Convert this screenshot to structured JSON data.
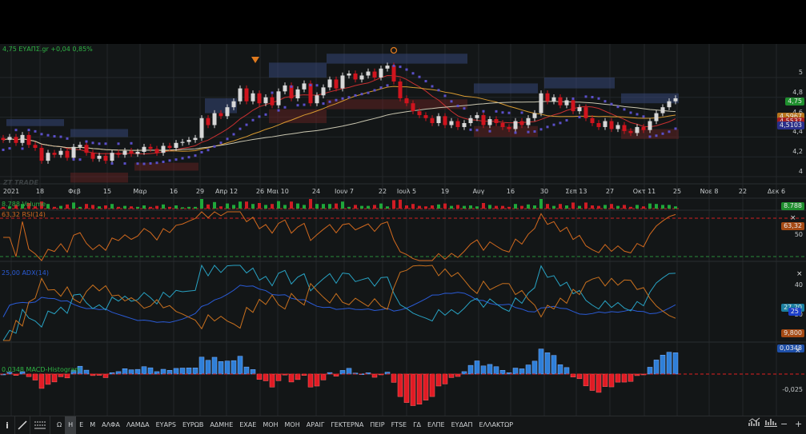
{
  "header": {
    "quote": "4,75 ΕΥΑΠΣ.gr +0,04 0,85%"
  },
  "watermark": "ZT TRADE",
  "colors": {
    "up": "#d8d8d8",
    "down": "#d0141e",
    "sma_fast": "#c83030",
    "sma_mid": "#d89a30",
    "sma_slow": "#c9c6b0",
    "sar": "#5a4fc8",
    "rsi": "#d2691e",
    "adx": "#2a5bd7",
    "di_plus": "#28a3c4",
    "di_minus": "#c8701e",
    "macd_pos": "#2f7fd8",
    "macd_neg": "#e01b24"
  },
  "price_axis": {
    "ticks": [
      "5",
      "4,8",
      "4,6",
      "4,4",
      "4,2",
      "4"
    ],
    "values": [
      5,
      4.8,
      4.6,
      4.4,
      4.2,
      4.0
    ]
  },
  "price_badges": [
    {
      "text": "4,75",
      "color": "#1f8f2e"
    },
    {
      "text": "4,5967",
      "color": "#b7741d"
    },
    {
      "text": "4,5537",
      "color": "#a51d1d"
    },
    {
      "text": "4,5103",
      "color": "#2a2f8a"
    }
  ],
  "x_axis": [
    "2021",
    "18",
    "Φεβ",
    "15",
    "Μαρ",
    "16",
    "29",
    "Απρ 12",
    "26",
    "Μαι 10",
    "24",
    "Ιουν 7",
    "22",
    "Ιουλ 5",
    "19",
    "Αυγ",
    "16",
    "30",
    "Σεπ 13",
    "27",
    "Οκτ 11",
    "25",
    "Νοε 8",
    "22",
    "Δεκ 6"
  ],
  "volume": {
    "label": "8.788 Volume",
    "badge": "8.788"
  },
  "rsi": {
    "label": "63,32 RSI(14)",
    "badge": "63,32",
    "tick": "50"
  },
  "adx": {
    "label": "25,00 ADX(14)",
    "tick_hi": "40",
    "tick_lo": "20",
    "badge_di_plus": "27,20",
    "badge_adx": "25",
    "badge_di_minus": "9,800"
  },
  "macd": {
    "label": "0,0348 MACD-Histogram",
    "badge": "0,0348",
    "tick": "-0,025"
  },
  "chart_data": {
    "type": "candlestick",
    "closes": [
      4.33,
      4.36,
      4.3,
      4.38,
      4.28,
      4.25,
      4.12,
      4.2,
      4.18,
      4.22,
      4.15,
      4.26,
      4.28,
      4.2,
      4.14,
      4.17,
      4.12,
      4.2,
      4.18,
      4.22,
      4.19,
      4.21,
      4.26,
      4.24,
      4.2,
      4.27,
      4.25,
      4.3,
      4.31,
      4.33,
      4.35,
      4.55,
      4.48,
      4.6,
      4.57,
      4.66,
      4.72,
      4.85,
      4.72,
      4.8,
      4.7,
      4.76,
      4.68,
      4.82,
      4.88,
      4.75,
      4.84,
      4.9,
      4.7,
      4.78,
      4.86,
      4.94,
      4.85,
      4.98,
      5.0,
      4.94,
      4.98,
      5.02,
      4.96,
      5.05,
      5.08,
      4.92,
      4.75,
      4.7,
      4.62,
      4.58,
      4.55,
      4.5,
      4.57,
      4.48,
      4.52,
      4.46,
      4.5,
      4.55,
      4.58,
      4.48,
      4.54,
      4.5,
      4.46,
      4.44,
      4.52,
      4.48,
      4.55,
      4.6,
      4.8,
      4.72,
      4.76,
      4.68,
      4.73,
      4.62,
      4.66,
      4.55,
      4.5,
      4.46,
      4.52,
      4.44,
      4.48,
      4.42,
      4.4,
      4.46,
      4.43,
      4.52,
      4.6,
      4.66,
      4.72,
      4.75
    ],
    "zones": [
      {
        "kind": "resistance",
        "from": 1,
        "to": 10,
        "low": 4.47,
        "high": 4.54
      },
      {
        "kind": "resistance",
        "from": 11,
        "to": 20,
        "low": 4.36,
        "high": 4.44
      },
      {
        "kind": "resistance",
        "from": 32,
        "to": 37,
        "low": 4.6,
        "high": 4.75
      },
      {
        "kind": "resistance",
        "from": 42,
        "to": 51,
        "low": 4.96,
        "high": 5.11
      },
      {
        "kind": "resistance",
        "from": 51,
        "to": 73,
        "low": 5.1,
        "high": 5.2
      },
      {
        "kind": "resistance",
        "from": 74,
        "to": 84,
        "low": 4.8,
        "high": 4.9
      },
      {
        "kind": "resistance",
        "from": 85,
        "to": 96,
        "low": 4.85,
        "high": 4.96
      },
      {
        "kind": "resistance",
        "from": 97,
        "to": 106,
        "low": 4.7,
        "high": 4.8
      },
      {
        "kind": "support",
        "from": 11,
        "to": 20,
        "low": 3.9,
        "high": 4.0
      },
      {
        "kind": "support",
        "from": 21,
        "to": 31,
        "low": 4.02,
        "high": 4.1
      },
      {
        "kind": "support",
        "from": 42,
        "to": 51,
        "low": 4.5,
        "high": 4.64
      },
      {
        "kind": "support",
        "from": 51,
        "to": 73,
        "low": 4.64,
        "high": 4.74
      },
      {
        "kind": "support",
        "from": 74,
        "to": 84,
        "low": 4.36,
        "high": 4.47
      },
      {
        "kind": "support",
        "from": 97,
        "to": 106,
        "low": 4.34,
        "high": 4.44
      }
    ]
  },
  "toolbar": {
    "items": [
      "Ω",
      "Η",
      "Ε",
      "Μ",
      "ΑΛΦΑ",
      "ΛΑΜΔΑ",
      "ΕΥΑPS",
      "ΕΥΡΩΒ",
      "ΑΔΜΗΕ",
      "ΕΧΑΕ",
      "ΜΟΗ",
      "ΜΟΗ",
      "ΑΡΑΙΓ",
      "ΓΕΚΤΕΡΝΑ",
      "ΠΕΙΡ",
      "FTSE",
      "ΓΔ",
      "ΕΛΠΕ",
      "ΕΥΔΑΠ",
      "ΕΛΛΑΚΤΩΡ"
    ],
    "selected": "Η",
    "info": "i",
    "minus": "−",
    "plus": "+"
  }
}
